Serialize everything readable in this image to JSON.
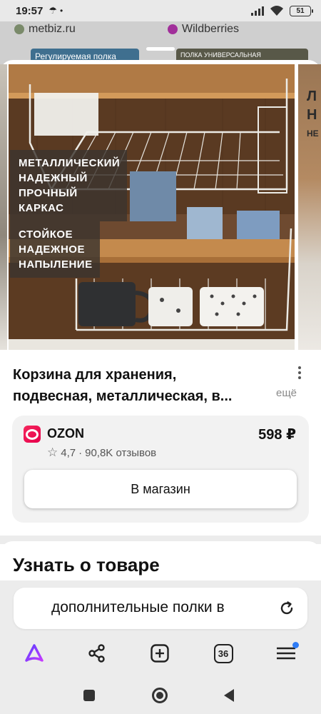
{
  "status_bar": {
    "time": "19:57",
    "battery": "51"
  },
  "background_page": {
    "left_site": "metbiz.ru",
    "right_site": "Wildberries",
    "left_thumb_text": "Регулируемая полка",
    "right_thumb_text": "ПОЛКА УНИВЕРСАЛЬНАЯ"
  },
  "product": {
    "image_captions": [
      [
        "МЕТАЛЛИЧЕСКИЙ",
        "НАДЕЖНЫЙ",
        "ПРОЧНЫЙ",
        "КАРКАС"
      ],
      [
        "СТОЙКОЕ",
        "НАДЕЖНОЕ",
        "НАПЫЛЕНИЕ"
      ]
    ],
    "side_fragment": [
      "Л",
      "Н",
      "НЕ"
    ],
    "title_line1": "Корзина для хранения,",
    "title_line2": "подвесная, металлическая, в...",
    "more_label": "ещё"
  },
  "offer": {
    "store_name": "OZON",
    "price": "598 ₽",
    "rating": "4,7",
    "separator": "·",
    "reviews": "90,8K отзывов",
    "button_label": "В магазин"
  },
  "section": {
    "title": "Узнать о товаре"
  },
  "search": {
    "query": "дополнительные полки в"
  },
  "toolbar": {
    "tabs_count": "36"
  }
}
